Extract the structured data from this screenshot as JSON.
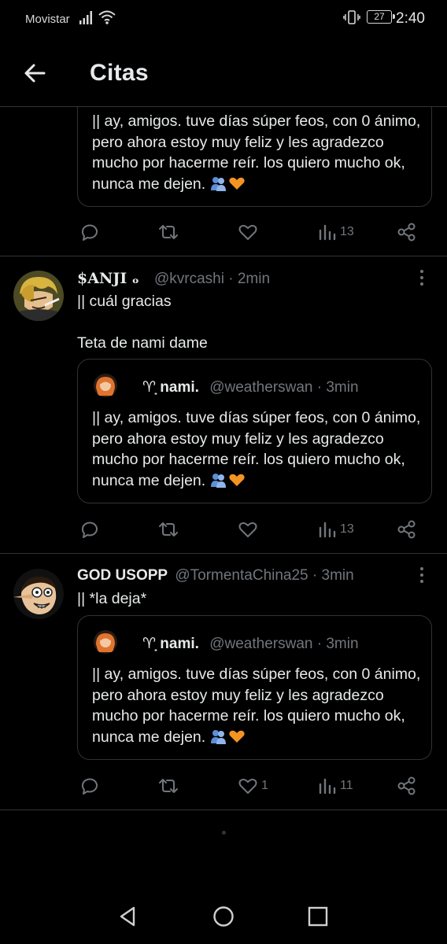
{
  "status_bar": {
    "carrier": "Movistar",
    "battery": "27",
    "time": "2:40"
  },
  "header": {
    "title": "Citas"
  },
  "top_partial": {
    "text": "|| ay, amigos. tuve días súper feos, con 0 ánimo, pero ahora estoy muy feliz y les agradezco mucho por hacerme reír. los quiero mucho ok, nunca me dejen.",
    "actions": {
      "views": "13"
    }
  },
  "tweets": [
    {
      "name": "$ANJI ₒ",
      "handle": "@kvrcashi",
      "time": "· 2min",
      "text_line1": "|| cuál gracias",
      "text_line2": "Teta de nami dame",
      "quote": {
        "name": "♈̣ nami.",
        "handle": "@weatherswan",
        "time": "· 3min",
        "text": "|| ay, amigos. tuve días súper feos, con 0 ánimo, pero ahora estoy muy feliz y les agradezco mucho por hacerme reír. los quiero mucho ok, nunca me dejen."
      },
      "actions": {
        "likes": "",
        "views": "13"
      }
    },
    {
      "name": "GOD USOPP",
      "handle": "@TormentaChina25",
      "time": "· 3min",
      "text_line1": "|| *la deja*",
      "quote": {
        "name": "♈̣ nami.",
        "handle": "@weatherswan",
        "time": "· 3min",
        "text": "|| ay, amigos. tuve días súper feos, con 0 ánimo, pero ahora estoy muy feliz y les agradezco mucho por hacerme reír. los quiero mucho ok, nunca me dejen."
      },
      "actions": {
        "likes": "1",
        "views": "11"
      }
    }
  ],
  "colors": {
    "background": "#000000",
    "text": "#e7e9ea",
    "muted": "#71767b",
    "border": "#2f3336"
  }
}
